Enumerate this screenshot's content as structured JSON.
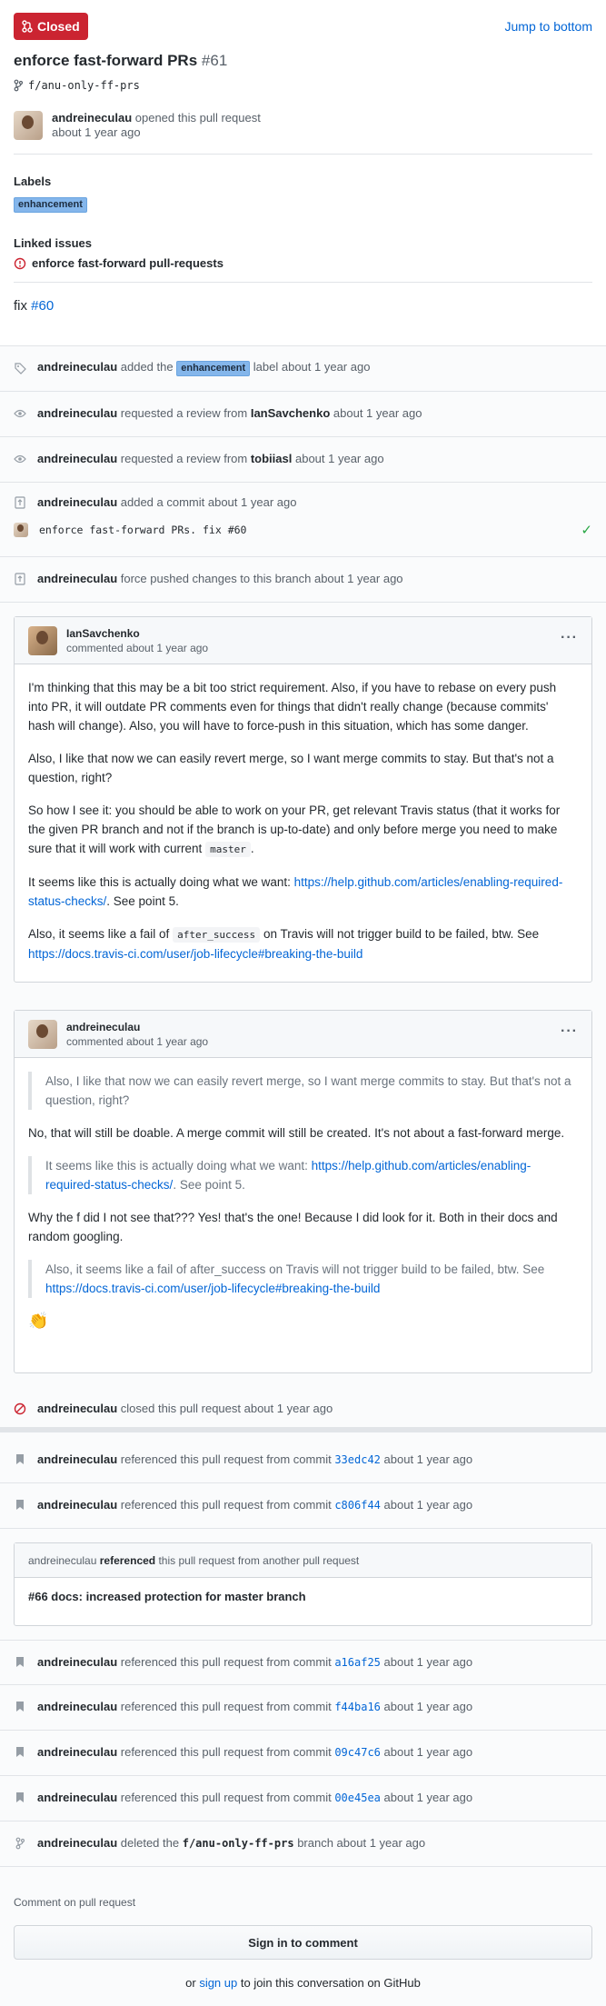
{
  "header": {
    "state": "Closed",
    "jump_link": "Jump to bottom",
    "title": "enforce fast-forward PRs",
    "number": "#61",
    "branch": "f/anu-only-ff-prs",
    "author": "andreineculau",
    "opened_text": "opened this pull request",
    "opened_time": "about 1 year ago",
    "labels_title": "Labels",
    "label": "enhancement",
    "linked_title": "Linked issues",
    "linked_issue": "enforce fast-forward pull-requests",
    "body_prefix": "fix",
    "body_link": "#60"
  },
  "events": {
    "label_added": {
      "actor": "andreineculau",
      "pre": "added the",
      "label": "enhancement",
      "post": "label about 1 year ago"
    },
    "review1": {
      "actor": "andreineculau",
      "pre": "requested a review from",
      "who": "IanSavchenko",
      "post": "about 1 year ago"
    },
    "review2": {
      "actor": "andreineculau",
      "pre": "requested a review from",
      "who": "tobiiasl",
      "post": "about 1 year ago"
    },
    "commit_added": {
      "actor": "andreineculau",
      "text": "added a commit about 1 year ago",
      "message": "enforce fast-forward PRs. fix #60"
    },
    "force_push": {
      "actor": "andreineculau",
      "text": "force pushed changes to this branch about 1 year ago"
    },
    "closed": {
      "actor": "andreineculau",
      "text": "closed this pull request about 1 year ago"
    },
    "ref1": {
      "actor": "andreineculau",
      "text": "referenced this pull request from commit",
      "sha": "33edc42",
      "time": "about 1 year ago"
    },
    "ref2": {
      "actor": "andreineculau",
      "text": "referenced this pull request from commit",
      "sha": "c806f44",
      "time": "about 1 year ago"
    },
    "ref_pr": {
      "actor": "andreineculau",
      "verb": "referenced",
      "rest": "this pull request from another pull request",
      "title": "#66 docs: increased protection for master branch"
    },
    "ref3": {
      "actor": "andreineculau",
      "text": "referenced this pull request from commit",
      "sha": "a16af25",
      "time": "about 1 year ago"
    },
    "ref4": {
      "actor": "andreineculau",
      "text": "referenced this pull request from commit",
      "sha": "f44ba16",
      "time": "about 1 year ago"
    },
    "ref5": {
      "actor": "andreineculau",
      "text": "referenced this pull request from commit",
      "sha": "09c47c6",
      "time": "about 1 year ago"
    },
    "ref6": {
      "actor": "andreineculau",
      "text": "referenced this pull request from commit",
      "sha": "00e45ea",
      "time": "about 1 year ago"
    },
    "deleted": {
      "actor": "andreineculau",
      "pre": "deleted the",
      "branch": "f/anu-only-ff-prs",
      "post": "branch about 1 year ago"
    }
  },
  "comment1": {
    "author": "IanSavchenko",
    "when": "commented about 1 year ago",
    "p1": "I'm thinking that this may be a bit too strict requirement. Also, if you have to rebase on every push into PR, it will outdate PR comments even for things that didn't really change (because commits' hash will change). Also, you will have to force-push in this situation, which has some danger.",
    "p2": "Also, I like that now we can easily revert merge, so I want merge commits to stay. But that's not a question, right?",
    "p3": "So how I see it: you should be able to work on your PR, get relevant Travis status (that it works for the given PR branch and not if the branch is up-to-date) and only before merge you need to make sure that it will work with current",
    "p3_code": "master",
    "p3_end": ".",
    "p4_pre": "It seems like this is actually doing what we want:",
    "p4_link": "https://help.github.com/articles/enabling-required-status-checks/",
    "p4_post": ". See point 5.",
    "p5_pre": "Also, it seems like a fail of",
    "p5_code": "after_success",
    "p5_mid": "on Travis will not trigger build to be failed, btw. See",
    "p5_link": "https://docs.travis-ci.com/user/job-lifecycle#breaking-the-build"
  },
  "comment2": {
    "author": "andreineculau",
    "when": "commented about 1 year ago",
    "q1": "Also, I like that now we can easily revert merge, so I want merge commits to stay. But that's not a question, right?",
    "p1": "No, that will still be doable. A merge commit will still be created. It's not about a fast-forward merge.",
    "q2_pre": "It seems like this is actually doing what we want:",
    "q2_link": "https://help.github.com/articles/enabling-required-status-checks/",
    "q2_post": ". See point 5.",
    "p2": "Why the f did I not see that??? Yes! that's the one! Because I did look for it. Both in their docs and random googling.",
    "q3_pre": "Also, it seems like a fail of after_success on Travis will not trigger build to be failed, btw. See",
    "q3_link": "https://docs.travis-ci.com/user/job-lifecycle#breaking-the-build",
    "emoji": "👏"
  },
  "footer": {
    "comment_title": "Comment on pull request",
    "signin": "Sign in to comment",
    "or": "or",
    "signup": "sign up",
    "join": "to join this conversation on GitHub"
  }
}
